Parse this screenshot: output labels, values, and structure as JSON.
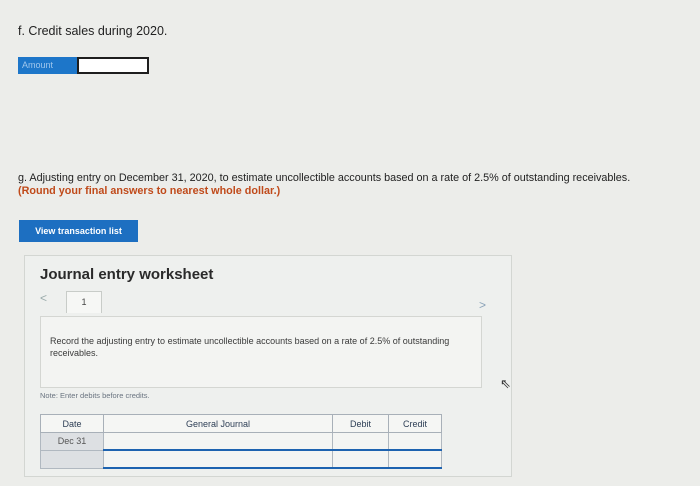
{
  "question_f": {
    "text": "f. Credit sales during 2020.",
    "amount_label": "Amount",
    "amount_value": ""
  },
  "question_g": {
    "text": "g. Adjusting entry on December 31, 2020, to estimate uncollectible accounts based on a rate of 2.5% of outstanding receivables.",
    "note": "(Round your final answers to nearest whole dollar.)"
  },
  "view_button_label": "View transaction list",
  "worksheet": {
    "title": "Journal entry worksheet",
    "prev_icon": "<",
    "next_icon": ">",
    "tab_label": "1",
    "instruction": "Record the adjusting entry to estimate uncollectible accounts based on a rate of 2.5% of outstanding receivables.",
    "note": "Note: Enter debits before credits."
  },
  "journal_table": {
    "headers": [
      "Date",
      "General Journal",
      "Debit",
      "Credit"
    ],
    "rows": [
      {
        "date": "Dec 31",
        "account": "",
        "debit": "",
        "credit": ""
      },
      {
        "date": "",
        "account": "",
        "debit": "",
        "credit": ""
      }
    ]
  },
  "colors": {
    "accent_blue": "#1d6fc1",
    "note_orange": "#c04a1a"
  }
}
